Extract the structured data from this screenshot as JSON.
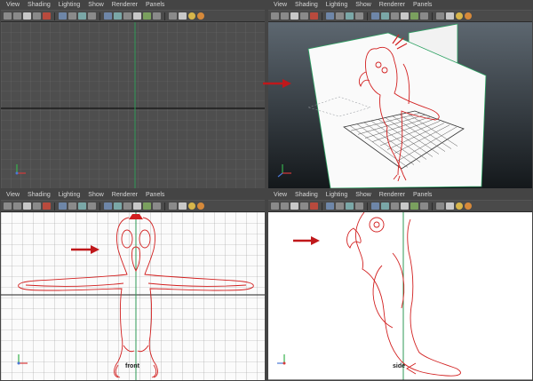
{
  "menus": [
    "View",
    "Shading",
    "Lighting",
    "Show",
    "Renderer",
    "Panels"
  ],
  "panes": {
    "front": {
      "camera_label": "front"
    },
    "side": {
      "camera_label": "side"
    }
  },
  "colors": {
    "curve": "#d22020",
    "grid_light": "#c9c9c9",
    "grid_dark": "#1e1e1e",
    "axis_green": "#2a8a4a",
    "arrow": "#c0181b"
  }
}
